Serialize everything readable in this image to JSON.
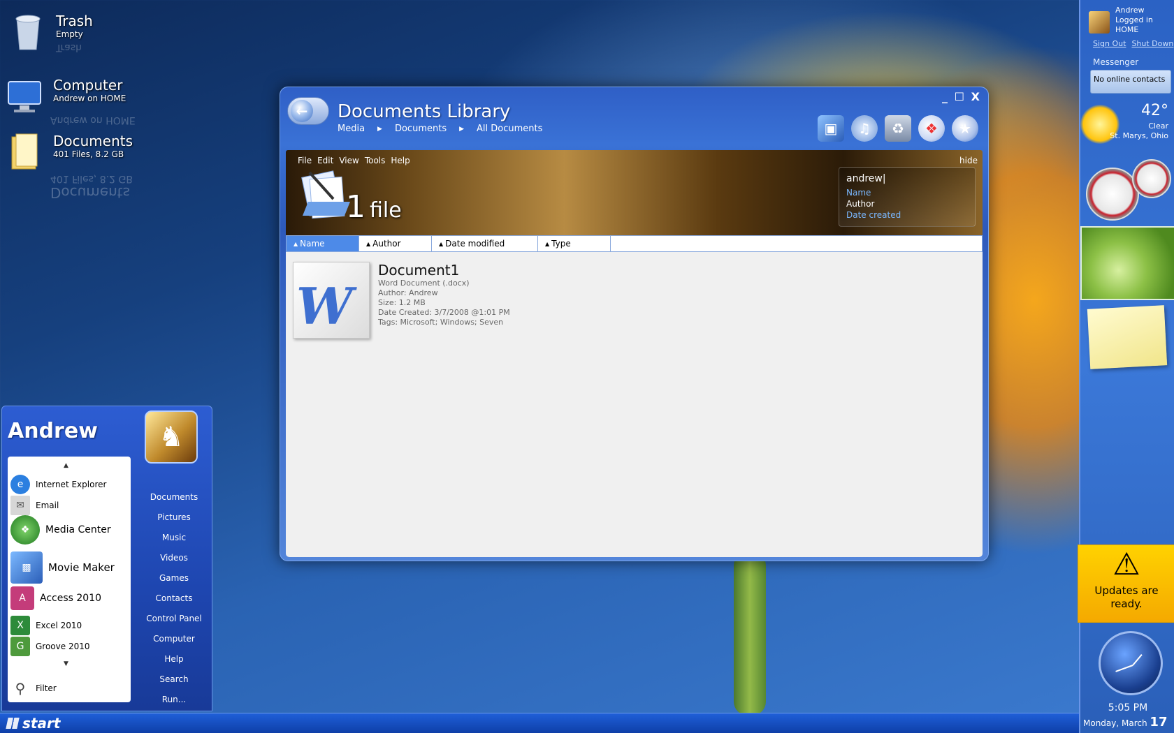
{
  "desktop": {
    "icons": [
      {
        "title": "Trash",
        "subtitle": "Empty"
      },
      {
        "title": "Computer",
        "subtitle": "Andrew on HOME"
      },
      {
        "title": "Documents",
        "subtitle": "401 Files, 8.2 GB"
      }
    ]
  },
  "window": {
    "title": "Documents Library",
    "breadcrumbs": [
      "Media",
      "Documents",
      "All  Documents"
    ],
    "menu": [
      "File",
      "Edit",
      "View",
      "Tools",
      "Help"
    ],
    "hide_label": "hide",
    "file_count": "1",
    "file_word": "file",
    "search": {
      "query": "andrew|",
      "options": [
        "Name",
        "Author",
        "Date created"
      ]
    },
    "columns": [
      "Name",
      "Author",
      "Date modified",
      "Type"
    ],
    "files": [
      {
        "name": "Document1",
        "type": "Word Document (.docx)",
        "author": "Author: Andrew",
        "size": "Size: 1.2 MB",
        "created": "Date Created:  3/7/2008 @1:01 PM",
        "tags": "Tags: Microsoft; Windows; Seven"
      }
    ]
  },
  "start_menu": {
    "user": "Andrew",
    "programs": [
      "Internet Explorer",
      "Email",
      "Media Center",
      "Movie Maker",
      "Access 2010",
      "Excel 2010",
      "Groove 2010"
    ],
    "filter_label": "Filter",
    "places": [
      "Documents",
      "Pictures",
      "Music",
      "Videos",
      "Games",
      "Contacts",
      "Control Panel",
      "Computer",
      "Help",
      "Search",
      "Run..."
    ]
  },
  "taskbar": {
    "start_label": "start"
  },
  "sidebar": {
    "user_name": "Andrew",
    "user_status": "Logged in",
    "user_host": "HOME",
    "sign_out": "Sign Out",
    "shut_down": "Shut Down",
    "messenger_title": "Messenger",
    "messenger_status": "No online contacts",
    "weather_temp": "42°",
    "weather_cond": "Clear",
    "weather_loc": "St. Marys, Ohio",
    "updates_msg": "Updates are ready.",
    "time": "5:05 PM",
    "date": "Monday, March",
    "day": "17"
  }
}
